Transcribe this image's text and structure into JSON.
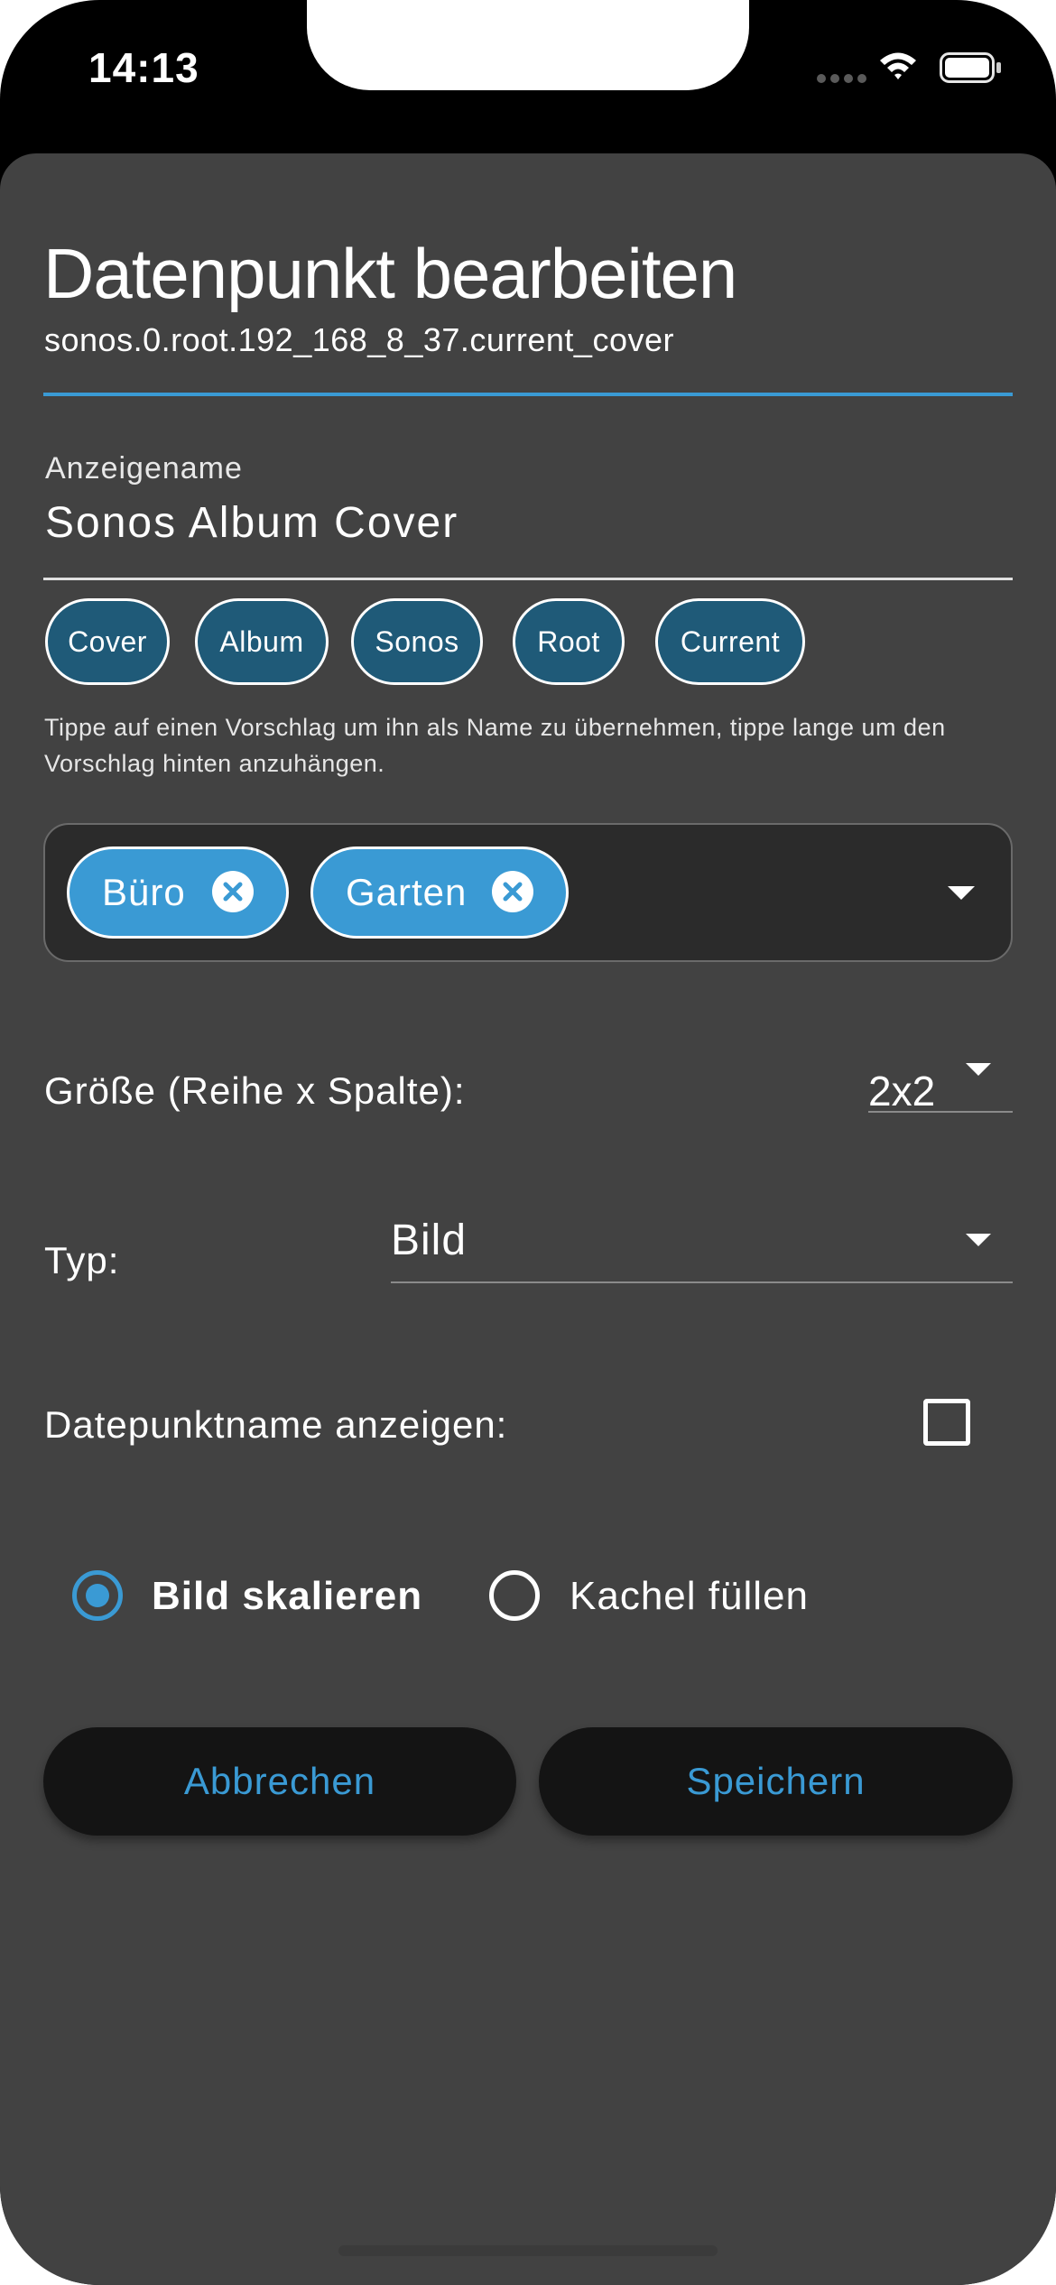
{
  "status_bar": {
    "time": "14:13",
    "icons": [
      "signal-dots-icon",
      "wifi-icon",
      "battery-icon"
    ]
  },
  "dialog": {
    "title": "Datenpunkt bearbeiten",
    "subtitle": "sonos.0.root.192_168_8_37.current_cover",
    "display_name": {
      "label": "Anzeigename",
      "value": "Sonos Album Cover"
    },
    "suggestions": [
      "Cover",
      "Album",
      "Sonos",
      "Root",
      "Current"
    ],
    "hint": "Tippe auf einen Vorschlag um ihn als Name zu übernehmen, tippe lange um den Vorschlag hinten anzuhängen.",
    "tags": [
      "Büro",
      "Garten"
    ],
    "size": {
      "label": "Größe (Reihe x Spalte):",
      "value": "2x2"
    },
    "type": {
      "label": "Typ:",
      "value": "Bild"
    },
    "show_name": {
      "label": "Datepunktname anzeigen:",
      "checked": false
    },
    "scale_options": [
      {
        "label": "Bild skalieren",
        "selected": true
      },
      {
        "label": "Kachel füllen",
        "selected": false
      }
    ],
    "buttons": {
      "cancel": "Abbrechen",
      "save": "Speichern"
    }
  },
  "colors": {
    "accent": "#3a9ad4",
    "sheet_bg": "#424242",
    "chip_bg": "#1f5a78",
    "tag_box_bg": "#2b2b2b",
    "button_bg": "#141414"
  }
}
